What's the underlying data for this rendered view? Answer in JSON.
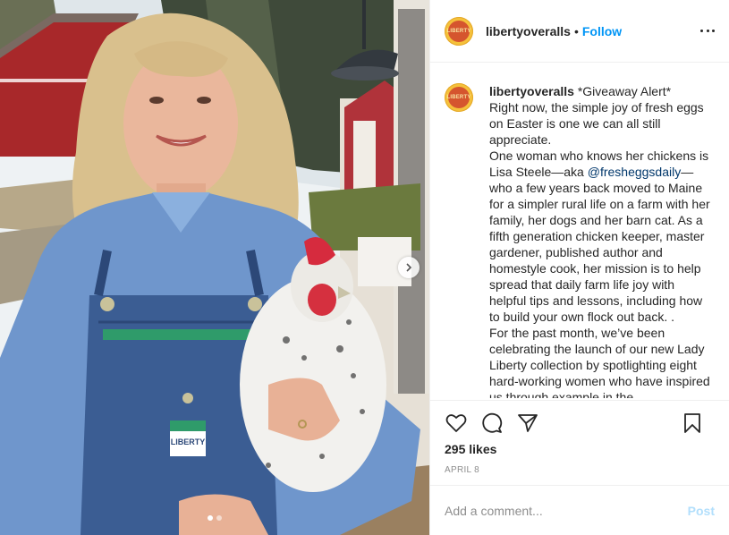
{
  "header": {
    "username": "libertyoveralls",
    "separator": "•",
    "follow_label": "Follow",
    "avatar_text": "LIBERTY"
  },
  "caption": {
    "username": "libertyoveralls",
    "lines": [
      "*Giveaway Alert*",
      "Right now, the simple joy of fresh eggs on Easter is one we can all still appreciate."
    ],
    "para2_before": "One woman who knows her chickens is Lisa Steele—aka ",
    "mention": "@fresheggsdaily",
    "para2_after": "— who a few years back moved to Maine for a simpler rural life on a farm with her family, her dogs and her barn cat. As a fifth generation chicken keeper, master gardener, published author and homestyle cook, her mission is to help spread that daily farm life joy with helpful tips and lessons, including how to build your own flock out back. .",
    "para3": "For the past month, we’ve been celebrating the launch of our new Lady Liberty collection by spotlighting eight hard-working women who have inspired us through example in the"
  },
  "photo": {
    "overalls_tag": "LIBERTY",
    "carousel_total": 2,
    "carousel_active": 1
  },
  "actions": {
    "icons": [
      "heart-icon",
      "comment-icon",
      "share-icon",
      "bookmark-icon"
    ]
  },
  "likes": "295 likes",
  "date": "APRIL 8",
  "comment": {
    "placeholder": "Add a comment...",
    "post_label": "Post"
  },
  "colors": {
    "link": "#0095f6",
    "mention": "#00376b",
    "muted": "#8e8e8e",
    "post_disabled": "#b2dffc"
  }
}
